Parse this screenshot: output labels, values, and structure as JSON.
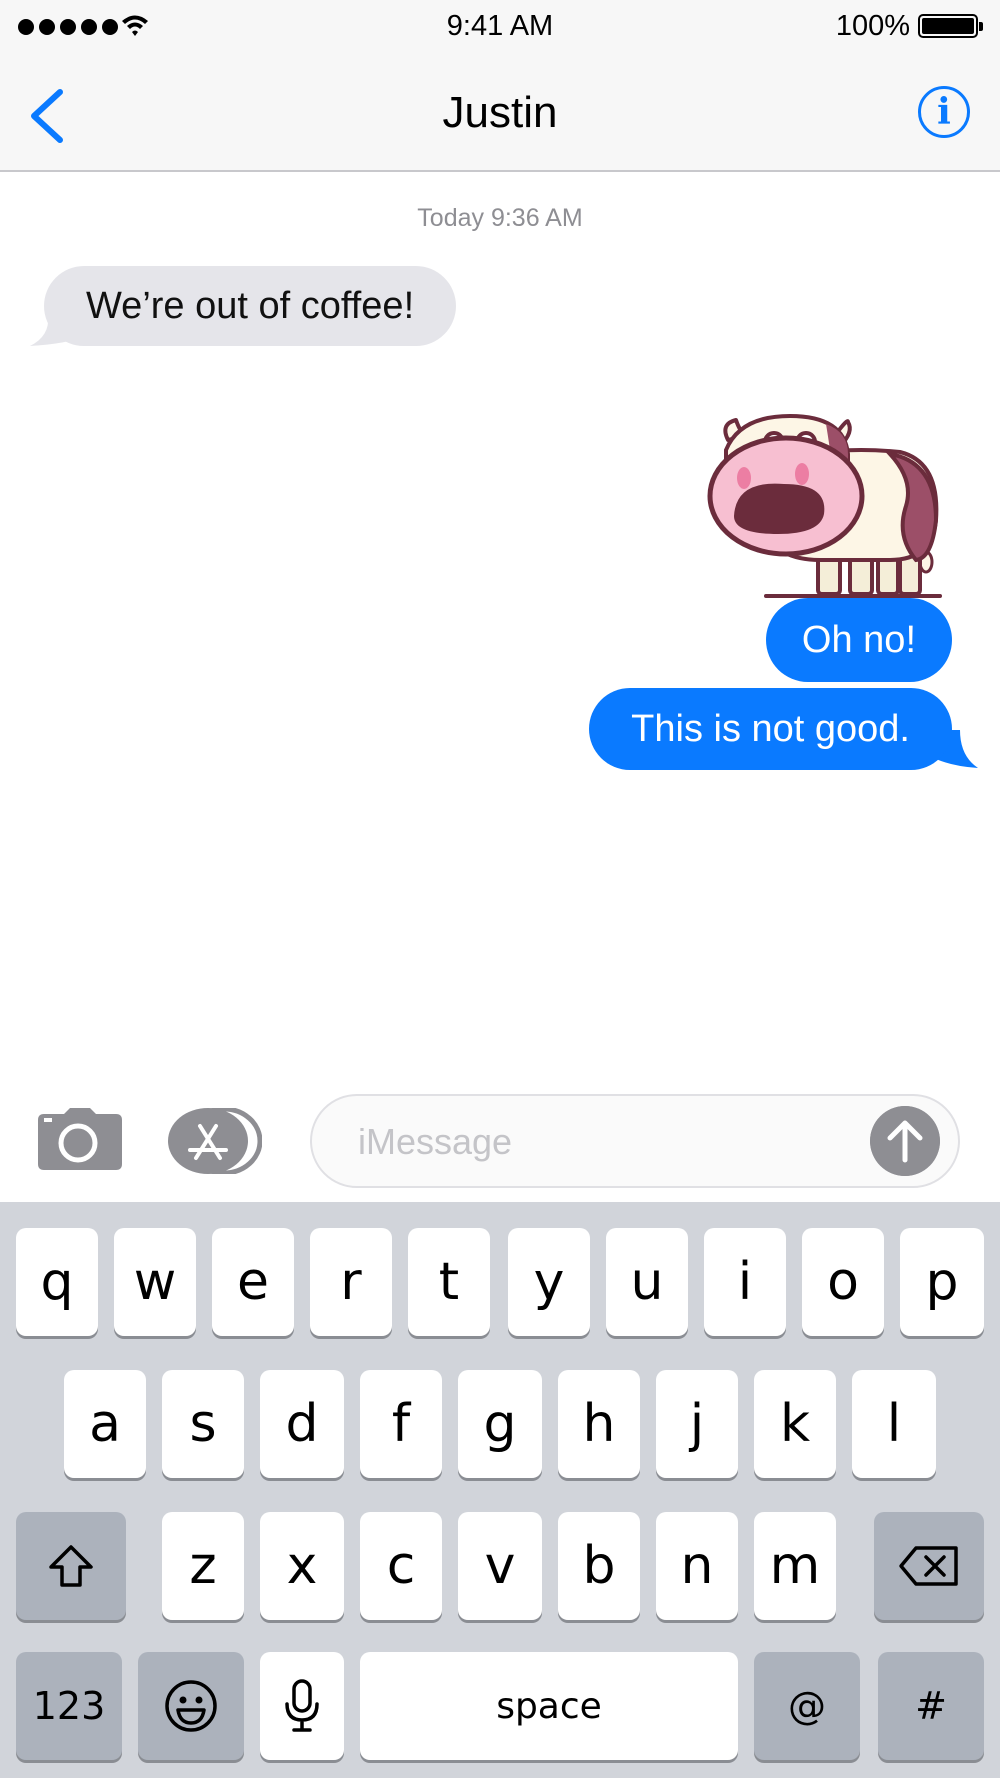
{
  "status_bar": {
    "time": "9:41 AM",
    "battery": "100%"
  },
  "nav": {
    "title": "Justin",
    "back_icon": "chevron-left-icon",
    "info_icon": "info-icon",
    "info_glyph": "i"
  },
  "conversation": {
    "timestamp": "Today 9:36 AM",
    "received": [
      "We’re out of coffee!"
    ],
    "sticker": "surprised-cow-sticker",
    "sent": [
      "Oh no!",
      "This is not good."
    ]
  },
  "composer": {
    "placeholder": "iMessage",
    "value": ""
  },
  "keyboard": {
    "row1": [
      "q",
      "w",
      "e",
      "r",
      "t",
      "y",
      "u",
      "i",
      "o",
      "p"
    ],
    "row2": [
      "a",
      "s",
      "d",
      "f",
      "g",
      "h",
      "j",
      "k",
      "l"
    ],
    "row3": [
      "z",
      "x",
      "c",
      "v",
      "b",
      "n",
      "m"
    ],
    "numbers_label": "123",
    "space_label": "space",
    "at_label": "@",
    "hash_label": "#"
  },
  "colors": {
    "accent": "#0a7aff",
    "received_bubble": "#e5e5ea",
    "keyboard_bg": "#d1d4da"
  }
}
